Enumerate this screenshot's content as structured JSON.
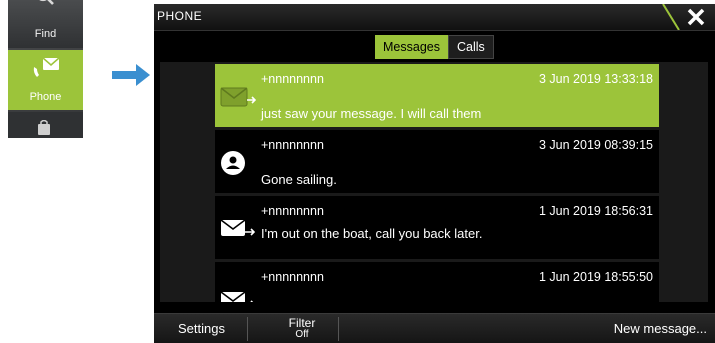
{
  "launcher": {
    "find_label": "Find",
    "phone_label": "Phone"
  },
  "window": {
    "title": "PHONE",
    "tabs": [
      {
        "label": "Messages",
        "active": true
      },
      {
        "label": "Calls",
        "active": false
      }
    ],
    "messages": [
      {
        "sender": "+nnnnnnnn",
        "date": "3 Jun 2019 13:33:18",
        "text": "just saw your message. I will call them",
        "icon": "outgoing-envelope-icon",
        "selected": true
      },
      {
        "sender": "+nnnnnnnn",
        "date": "3 Jun 2019 08:39:15",
        "text": "Gone sailing.",
        "icon": "contact-avatar-icon",
        "selected": false
      },
      {
        "sender": "+nnnnnnnn",
        "date": "1 Jun 2019 18:56:31",
        "text": "I'm out on the boat, call you back later.",
        "icon": "outgoing-envelope-icon",
        "selected": false
      },
      {
        "sender": "+nnnnnnnn",
        "date": "1 Jun 2019 18:55:50",
        "text": "",
        "icon": "outgoing-envelope-icon",
        "selected": false
      }
    ],
    "bottom_bar": {
      "settings_label": "Settings",
      "filter_label": "Filter",
      "filter_value": "Off",
      "new_message_label": "New message..."
    }
  },
  "colors": {
    "accent": "#9cc43a",
    "window_bg": "#000000",
    "pointer_arrow": "#3a8fd0"
  }
}
